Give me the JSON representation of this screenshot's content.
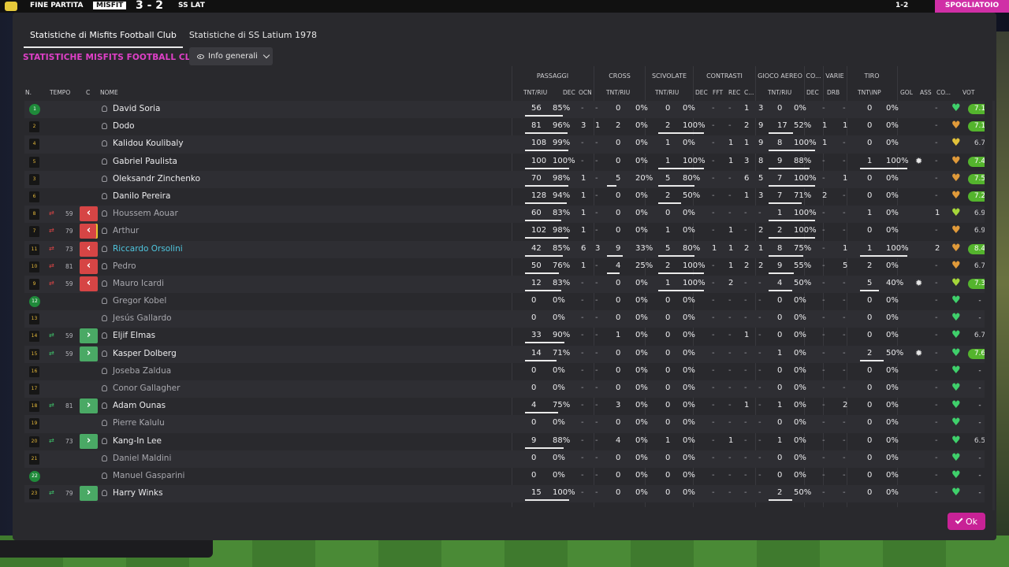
{
  "topbar": {
    "left_label": "FINE PARTITA",
    "home_short": "MISFIT",
    "score": "3 - 2",
    "away_short": "SS LAT",
    "clock": "1-2",
    "right_button": "SPOGLIATOIO"
  },
  "tabs": [
    {
      "label": "Statistiche di Misfits Football Club",
      "active": true
    },
    {
      "label": "Statistiche di SS Latium 1978",
      "active": false
    }
  ],
  "title": "STATISTICHE MISFITS FOOTBALL CLUB",
  "info_button": "Info generali",
  "groups": [
    "PASSAGGI",
    "CROSS",
    "SCIVOLATE",
    "CONTRASTI",
    "GIOCO AEREO",
    "CO...",
    "VARIE",
    "TIRO"
  ],
  "headers": {
    "n": "N.",
    "tempo": "TEMPO",
    "c": "C",
    "nome": "NOME",
    "pass_tr": "TNT/RIU",
    "pass_dec": "DEC",
    "pass_ocn": "OCN",
    "cross_tr": "TNT/RIU",
    "sciv_tr": "TNT/RIU",
    "con_dec": "DEC",
    "con_fft": "FFT",
    "con_rec": "REC",
    "con_c": "C...",
    "aer_tr": "TNT/RIU",
    "co_dec": "DEC",
    "var_drb": "DRB",
    "tiro_tr": "TNT\\INP",
    "gol": "GOL",
    "ass": "ASS",
    "co": "CO...",
    "vot": "VOT"
  },
  "players": [
    {
      "num": "1",
      "gk": true,
      "sub": "",
      "min": "",
      "name": "David Soria",
      "style": "",
      "pt": "56",
      "pp": "85%",
      "pdec": "-",
      "pocn": "-",
      "ct": "0",
      "cp": "0%",
      "st": "0",
      "sp": "0%",
      "cdec": "-",
      "cfft": "-",
      "crec": "1",
      "cc": "3",
      "at": "0",
      "ap": "0%",
      "codec": "-",
      "drb": "-",
      "tt": "0",
      "tp": "0%",
      "gol": "",
      "ass": "-",
      "cond": "#3fd06b",
      "vot": "7.1",
      "vg": true
    },
    {
      "num": "2",
      "gk": false,
      "sub": "",
      "min": "",
      "name": "Dodo",
      "style": "",
      "pt": "81",
      "pp": "96%",
      "pdec": "3",
      "pocn": "1",
      "ct": "2",
      "cp": "0%",
      "st": "2",
      "sp": "100%",
      "cdec": "-",
      "cfft": "-",
      "crec": "2",
      "cc": "9",
      "at": "17",
      "ap": "52%",
      "codec": "1",
      "drb": "1",
      "tt": "0",
      "tp": "0%",
      "gol": "",
      "ass": "-",
      "cond": "#e09a3a",
      "vot": "7.1",
      "vg": true
    },
    {
      "num": "4",
      "gk": false,
      "sub": "",
      "min": "",
      "name": "Kalidou Koulibaly",
      "style": "",
      "pt": "108",
      "pp": "99%",
      "pdec": "-",
      "pocn": "-",
      "ct": "0",
      "cp": "0%",
      "st": "1",
      "sp": "0%",
      "cdec": "-",
      "cfft": "1",
      "crec": "1",
      "cc": "9",
      "at": "8",
      "ap": "100%",
      "codec": "1",
      "drb": "-",
      "tt": "0",
      "tp": "0%",
      "gol": "",
      "ass": "-",
      "cond": "#e2c23a",
      "vot": "6.7",
      "vg": false
    },
    {
      "num": "5",
      "gk": false,
      "sub": "",
      "min": "",
      "name": "Gabriel Paulista",
      "style": "",
      "pt": "100",
      "pp": "100%",
      "pdec": "-",
      "pocn": "-",
      "ct": "0",
      "cp": "0%",
      "st": "1",
      "sp": "100%",
      "cdec": "-",
      "cfft": "1",
      "crec": "3",
      "cc": "8",
      "at": "9",
      "ap": "88%",
      "codec": "-",
      "drb": "-",
      "tt": "1",
      "tp": "100%",
      "gol": "gear",
      "ass": "-",
      "cond": "#e09a3a",
      "vot": "7.4",
      "vg": true
    },
    {
      "num": "3",
      "gk": false,
      "sub": "",
      "min": "",
      "name": "Oleksandr Zinchenko",
      "style": "",
      "pt": "70",
      "pp": "98%",
      "pdec": "1",
      "pocn": "-",
      "ct": "5",
      "cp": "20%",
      "st": "5",
      "sp": "80%",
      "cdec": "-",
      "cfft": "-",
      "crec": "6",
      "cc": "5",
      "at": "7",
      "ap": "100%",
      "codec": "-",
      "drb": "1",
      "tt": "0",
      "tp": "0%",
      "gol": "",
      "ass": "-",
      "cond": "#e09a3a",
      "vot": "7.5",
      "vg": true
    },
    {
      "num": "6",
      "gk": false,
      "sub": "",
      "min": "",
      "name": "Danilo Pereira",
      "style": "",
      "pt": "128",
      "pp": "94%",
      "pdec": "1",
      "pocn": "-",
      "ct": "0",
      "cp": "0%",
      "st": "2",
      "sp": "50%",
      "cdec": "-",
      "cfft": "-",
      "crec": "1",
      "cc": "3",
      "at": "7",
      "ap": "71%",
      "codec": "2",
      "drb": "-",
      "tt": "0",
      "tp": "0%",
      "gol": "",
      "ass": "-",
      "cond": "#e09a3a",
      "vot": "7.2",
      "vg": true
    },
    {
      "num": "8",
      "gk": false,
      "sub": "out",
      "min": "59",
      "name": "Houssem Aouar",
      "style": "sub",
      "pt": "60",
      "pp": "83%",
      "pdec": "1",
      "pocn": "-",
      "ct": "0",
      "cp": "0%",
      "st": "0",
      "sp": "0%",
      "cdec": "-",
      "cfft": "-",
      "crec": "-",
      "cc": "-",
      "at": "1",
      "ap": "100%",
      "codec": "-",
      "drb": "-",
      "tt": "1",
      "tp": "0%",
      "gol": "",
      "ass": "1",
      "cond": "#a5d63a",
      "vot": "6.9",
      "vg": false
    },
    {
      "num": "7",
      "gk": false,
      "sub": "outw",
      "min": "79",
      "name": "Arthur",
      "style": "sub",
      "pt": "102",
      "pp": "98%",
      "pdec": "1",
      "pocn": "-",
      "ct": "0",
      "cp": "0%",
      "st": "1",
      "sp": "0%",
      "cdec": "-",
      "cfft": "1",
      "crec": "-",
      "cc": "2",
      "at": "2",
      "ap": "100%",
      "codec": "-",
      "drb": "-",
      "tt": "0",
      "tp": "0%",
      "gol": "",
      "ass": "-",
      "cond": "#e09a3a",
      "vot": "6.9",
      "vg": false
    },
    {
      "num": "11",
      "gk": false,
      "sub": "out",
      "min": "73",
      "name": "Riccardo Orsolini",
      "style": "hi",
      "pt": "42",
      "pp": "85%",
      "pdec": "6",
      "pocn": "3",
      "ct": "9",
      "cp": "33%",
      "st": "5",
      "sp": "80%",
      "cdec": "1",
      "cfft": "1",
      "crec": "2",
      "cc": "1",
      "at": "8",
      "ap": "75%",
      "codec": "-",
      "drb": "1",
      "tt": "1",
      "tp": "100%",
      "gol": "",
      "ass": "2",
      "cond": "#e09a3a",
      "vot": "8.4",
      "vg": true
    },
    {
      "num": "10",
      "gk": false,
      "sub": "out",
      "min": "81",
      "name": "Pedro",
      "style": "sub",
      "pt": "50",
      "pp": "76%",
      "pdec": "1",
      "pocn": "-",
      "ct": "4",
      "cp": "25%",
      "st": "2",
      "sp": "100%",
      "cdec": "-",
      "cfft": "1",
      "crec": "2",
      "cc": "2",
      "at": "9",
      "ap": "55%",
      "codec": "-",
      "drb": "5",
      "tt": "2",
      "tp": "0%",
      "gol": "",
      "ass": "-",
      "cond": "#e09a3a",
      "vot": "6.7",
      "vg": false
    },
    {
      "num": "9",
      "gk": false,
      "sub": "out",
      "min": "59",
      "name": "Mauro Icardi",
      "style": "sub",
      "pt": "12",
      "pp": "83%",
      "pdec": "-",
      "pocn": "-",
      "ct": "0",
      "cp": "0%",
      "st": "1",
      "sp": "100%",
      "cdec": "-",
      "cfft": "2",
      "crec": "-",
      "cc": "-",
      "at": "4",
      "ap": "50%",
      "codec": "-",
      "drb": "-",
      "tt": "5",
      "tp": "40%",
      "gol": "gear",
      "ass": "-",
      "cond": "#a5d63a",
      "vot": "7.3",
      "vg": true
    },
    {
      "num": "12",
      "gk": true,
      "sub": "",
      "min": "",
      "name": "Gregor Kobel",
      "style": "sub",
      "pt": "0",
      "pp": "0%",
      "pdec": "-",
      "pocn": "-",
      "ct": "0",
      "cp": "0%",
      "st": "0",
      "sp": "0%",
      "cdec": "-",
      "cfft": "-",
      "crec": "-",
      "cc": "-",
      "at": "0",
      "ap": "0%",
      "codec": "-",
      "drb": "-",
      "tt": "0",
      "tp": "0%",
      "gol": "",
      "ass": "-",
      "cond": "#3fd06b",
      "vot": "-",
      "vg": false
    },
    {
      "num": "13",
      "gk": false,
      "sub": "",
      "min": "",
      "name": "Jesús Gallardo",
      "style": "sub",
      "pt": "0",
      "pp": "0%",
      "pdec": "-",
      "pocn": "-",
      "ct": "0",
      "cp": "0%",
      "st": "0",
      "sp": "0%",
      "cdec": "-",
      "cfft": "-",
      "crec": "-",
      "cc": "-",
      "at": "0",
      "ap": "0%",
      "codec": "-",
      "drb": "-",
      "tt": "0",
      "tp": "0%",
      "gol": "",
      "ass": "-",
      "cond": "#3fd06b",
      "vot": "-",
      "vg": false
    },
    {
      "num": "14",
      "gk": false,
      "sub": "in",
      "min": "59",
      "name": "Eljif Elmas",
      "style": "",
      "pt": "33",
      "pp": "90%",
      "pdec": "-",
      "pocn": "-",
      "ct": "1",
      "cp": "0%",
      "st": "0",
      "sp": "0%",
      "cdec": "-",
      "cfft": "-",
      "crec": "1",
      "cc": "-",
      "at": "0",
      "ap": "0%",
      "codec": "-",
      "drb": "-",
      "tt": "0",
      "tp": "0%",
      "gol": "",
      "ass": "-",
      "cond": "#3fd06b",
      "vot": "6.7",
      "vg": false
    },
    {
      "num": "15",
      "gk": false,
      "sub": "in",
      "min": "59",
      "name": "Kasper Dolberg",
      "style": "",
      "pt": "14",
      "pp": "71%",
      "pdec": "-",
      "pocn": "-",
      "ct": "0",
      "cp": "0%",
      "st": "0",
      "sp": "0%",
      "cdec": "-",
      "cfft": "-",
      "crec": "-",
      "cc": "-",
      "at": "1",
      "ap": "0%",
      "codec": "-",
      "drb": "-",
      "tt": "2",
      "tp": "50%",
      "gol": "gear",
      "ass": "-",
      "cond": "#3fd06b",
      "vot": "7.6",
      "vg": true
    },
    {
      "num": "16",
      "gk": false,
      "sub": "",
      "min": "",
      "name": "Joseba Zaldua",
      "style": "sub",
      "pt": "0",
      "pp": "0%",
      "pdec": "-",
      "pocn": "-",
      "ct": "0",
      "cp": "0%",
      "st": "0",
      "sp": "0%",
      "cdec": "-",
      "cfft": "-",
      "crec": "-",
      "cc": "-",
      "at": "0",
      "ap": "0%",
      "codec": "-",
      "drb": "-",
      "tt": "0",
      "tp": "0%",
      "gol": "",
      "ass": "-",
      "cond": "#3fd06b",
      "vot": "-",
      "vg": false
    },
    {
      "num": "17",
      "gk": false,
      "sub": "",
      "min": "",
      "name": "Conor Gallagher",
      "style": "sub",
      "pt": "0",
      "pp": "0%",
      "pdec": "-",
      "pocn": "-",
      "ct": "0",
      "cp": "0%",
      "st": "0",
      "sp": "0%",
      "cdec": "-",
      "cfft": "-",
      "crec": "-",
      "cc": "-",
      "at": "0",
      "ap": "0%",
      "codec": "-",
      "drb": "-",
      "tt": "0",
      "tp": "0%",
      "gol": "",
      "ass": "-",
      "cond": "#3fd06b",
      "vot": "-",
      "vg": false
    },
    {
      "num": "18",
      "gk": false,
      "sub": "in",
      "min": "81",
      "name": "Adam Ounas",
      "style": "",
      "pt": "4",
      "pp": "75%",
      "pdec": "-",
      "pocn": "-",
      "ct": "3",
      "cp": "0%",
      "st": "0",
      "sp": "0%",
      "cdec": "-",
      "cfft": "-",
      "crec": "1",
      "cc": "-",
      "at": "1",
      "ap": "0%",
      "codec": "-",
      "drb": "2",
      "tt": "0",
      "tp": "0%",
      "gol": "",
      "ass": "-",
      "cond": "#3fd06b",
      "vot": "-",
      "vg": false
    },
    {
      "num": "19",
      "gk": false,
      "sub": "",
      "min": "",
      "name": "Pierre Kalulu",
      "style": "sub",
      "pt": "0",
      "pp": "0%",
      "pdec": "-",
      "pocn": "-",
      "ct": "0",
      "cp": "0%",
      "st": "0",
      "sp": "0%",
      "cdec": "-",
      "cfft": "-",
      "crec": "-",
      "cc": "-",
      "at": "0",
      "ap": "0%",
      "codec": "-",
      "drb": "-",
      "tt": "0",
      "tp": "0%",
      "gol": "",
      "ass": "-",
      "cond": "#3fd06b",
      "vot": "-",
      "vg": false
    },
    {
      "num": "20",
      "gk": false,
      "sub": "in",
      "min": "73",
      "name": "Kang-In Lee",
      "style": "",
      "pt": "9",
      "pp": "88%",
      "pdec": "-",
      "pocn": "-",
      "ct": "4",
      "cp": "0%",
      "st": "1",
      "sp": "0%",
      "cdec": "-",
      "cfft": "1",
      "crec": "-",
      "cc": "-",
      "at": "1",
      "ap": "0%",
      "codec": "-",
      "drb": "-",
      "tt": "0",
      "tp": "0%",
      "gol": "",
      "ass": "-",
      "cond": "#3fd06b",
      "vot": "6.5",
      "vg": false
    },
    {
      "num": "21",
      "gk": false,
      "sub": "",
      "min": "",
      "name": "Daniel Maldini",
      "style": "sub",
      "pt": "0",
      "pp": "0%",
      "pdec": "-",
      "pocn": "-",
      "ct": "0",
      "cp": "0%",
      "st": "0",
      "sp": "0%",
      "cdec": "-",
      "cfft": "-",
      "crec": "-",
      "cc": "-",
      "at": "0",
      "ap": "0%",
      "codec": "-",
      "drb": "-",
      "tt": "0",
      "tp": "0%",
      "gol": "",
      "ass": "-",
      "cond": "#3fd06b",
      "vot": "-",
      "vg": false
    },
    {
      "num": "22",
      "gk": true,
      "sub": "",
      "min": "",
      "name": "Manuel Gasparini",
      "style": "sub",
      "pt": "0",
      "pp": "0%",
      "pdec": "-",
      "pocn": "-",
      "ct": "0",
      "cp": "0%",
      "st": "0",
      "sp": "0%",
      "cdec": "-",
      "cfft": "-",
      "crec": "-",
      "cc": "-",
      "at": "0",
      "ap": "0%",
      "codec": "-",
      "drb": "-",
      "tt": "0",
      "tp": "0%",
      "gol": "",
      "ass": "-",
      "cond": "#3fd06b",
      "vot": "-",
      "vg": false
    },
    {
      "num": "23",
      "gk": false,
      "sub": "in",
      "min": "79",
      "name": "Harry Winks",
      "style": "",
      "pt": "15",
      "pp": "100%",
      "pdec": "-",
      "pocn": "-",
      "ct": "0",
      "cp": "0%",
      "st": "0",
      "sp": "0%",
      "cdec": "-",
      "cfft": "-",
      "crec": "-",
      "cc": "-",
      "at": "2",
      "ap": "50%",
      "codec": "-",
      "drb": "-",
      "tt": "0",
      "tp": "0%",
      "gol": "",
      "ass": "-",
      "cond": "#3fd06b",
      "vot": "-",
      "vg": false
    }
  ],
  "ok_button": "Ok"
}
